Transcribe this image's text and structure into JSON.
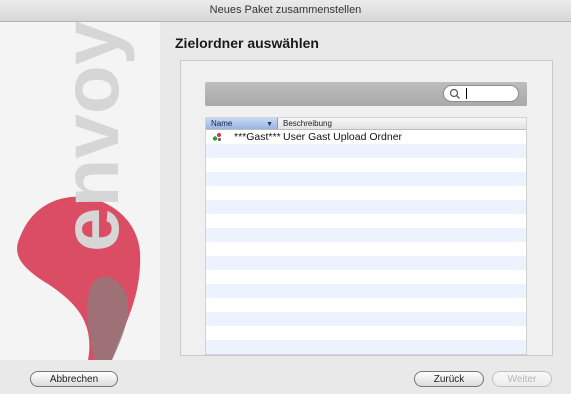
{
  "window": {
    "title": "Neues Paket zusammenstellen"
  },
  "sidebar": {
    "logo_text": "envoy",
    "brand_color": "#d9435d"
  },
  "page": {
    "title": "Zielordner auswählen"
  },
  "search": {
    "placeholder": "",
    "value": ""
  },
  "table": {
    "columns": [
      "Name",
      "Beschreibung"
    ],
    "sort_column": "Name",
    "rows": [
      {
        "name": "***Gast***",
        "description": "User Gast Upload Ordner"
      }
    ]
  },
  "buttons": {
    "cancel": "Abbrechen",
    "back": "Zurück",
    "next": "Weiter"
  }
}
